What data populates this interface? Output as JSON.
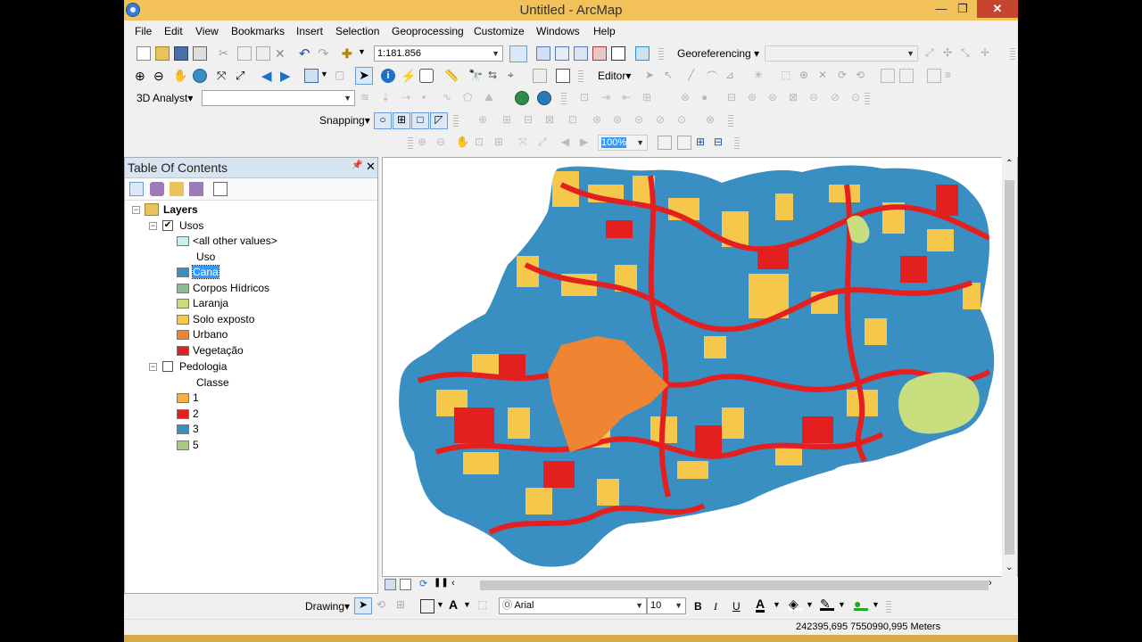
{
  "window": {
    "title": "Untitled - ArcMap",
    "minimize": "—",
    "maximize": "❐",
    "close": "✕"
  },
  "menu": [
    "File",
    "Edit",
    "View",
    "Bookmarks",
    "Insert",
    "Selection",
    "Geoprocessing",
    "Customize",
    "Windows",
    "Help"
  ],
  "toolbar": {
    "scale": "1:181.856",
    "georeferencing": "Georeferencing",
    "editor": "Editor",
    "analyst3d": "3D Analyst",
    "snapping": "Snapping",
    "zoom_percent": "100%"
  },
  "toc": {
    "title": "Table Of Contents",
    "pin": "📌",
    "close": "✕",
    "layers_label": "Layers",
    "usos": {
      "name": "Usos",
      "checked": true,
      "other_values": "<all other values>",
      "field": "Uso",
      "classes": [
        {
          "label": "Cana",
          "color": "#3a8fc2",
          "selected": true
        },
        {
          "label": "Corpos Hídricos",
          "color": "#8fbc8f"
        },
        {
          "label": "Laranja",
          "color": "#c9df7f"
        },
        {
          "label": "Solo exposto",
          "color": "#f5c84c"
        },
        {
          "label": "Urbano",
          "color": "#ef8433"
        },
        {
          "label": "Vegetação",
          "color": "#e41f1f"
        }
      ]
    },
    "pedologia": {
      "name": "Pedologia",
      "checked": false,
      "field": "Classe",
      "classes": [
        {
          "label": "1",
          "color": "#f5b04a"
        },
        {
          "label": "2",
          "color": "#e41f1f"
        },
        {
          "label": "3",
          "color": "#3a8fc2"
        },
        {
          "label": "5",
          "color": "#a8c97f"
        }
      ]
    }
  },
  "drawing": {
    "label": "Drawing",
    "font": "Arial",
    "size": "10",
    "bold": "B",
    "italic": "I",
    "underline": "U",
    "font_color_glyph": "A"
  },
  "status": {
    "coordinates": "242395,695  7550990,995 Meters"
  },
  "map_colors": {
    "cana": "#3a8fc2",
    "urbano": "#ef8433",
    "vegetacao": "#e41f1f",
    "solo": "#f5c84c",
    "laranja": "#c9df7f"
  }
}
